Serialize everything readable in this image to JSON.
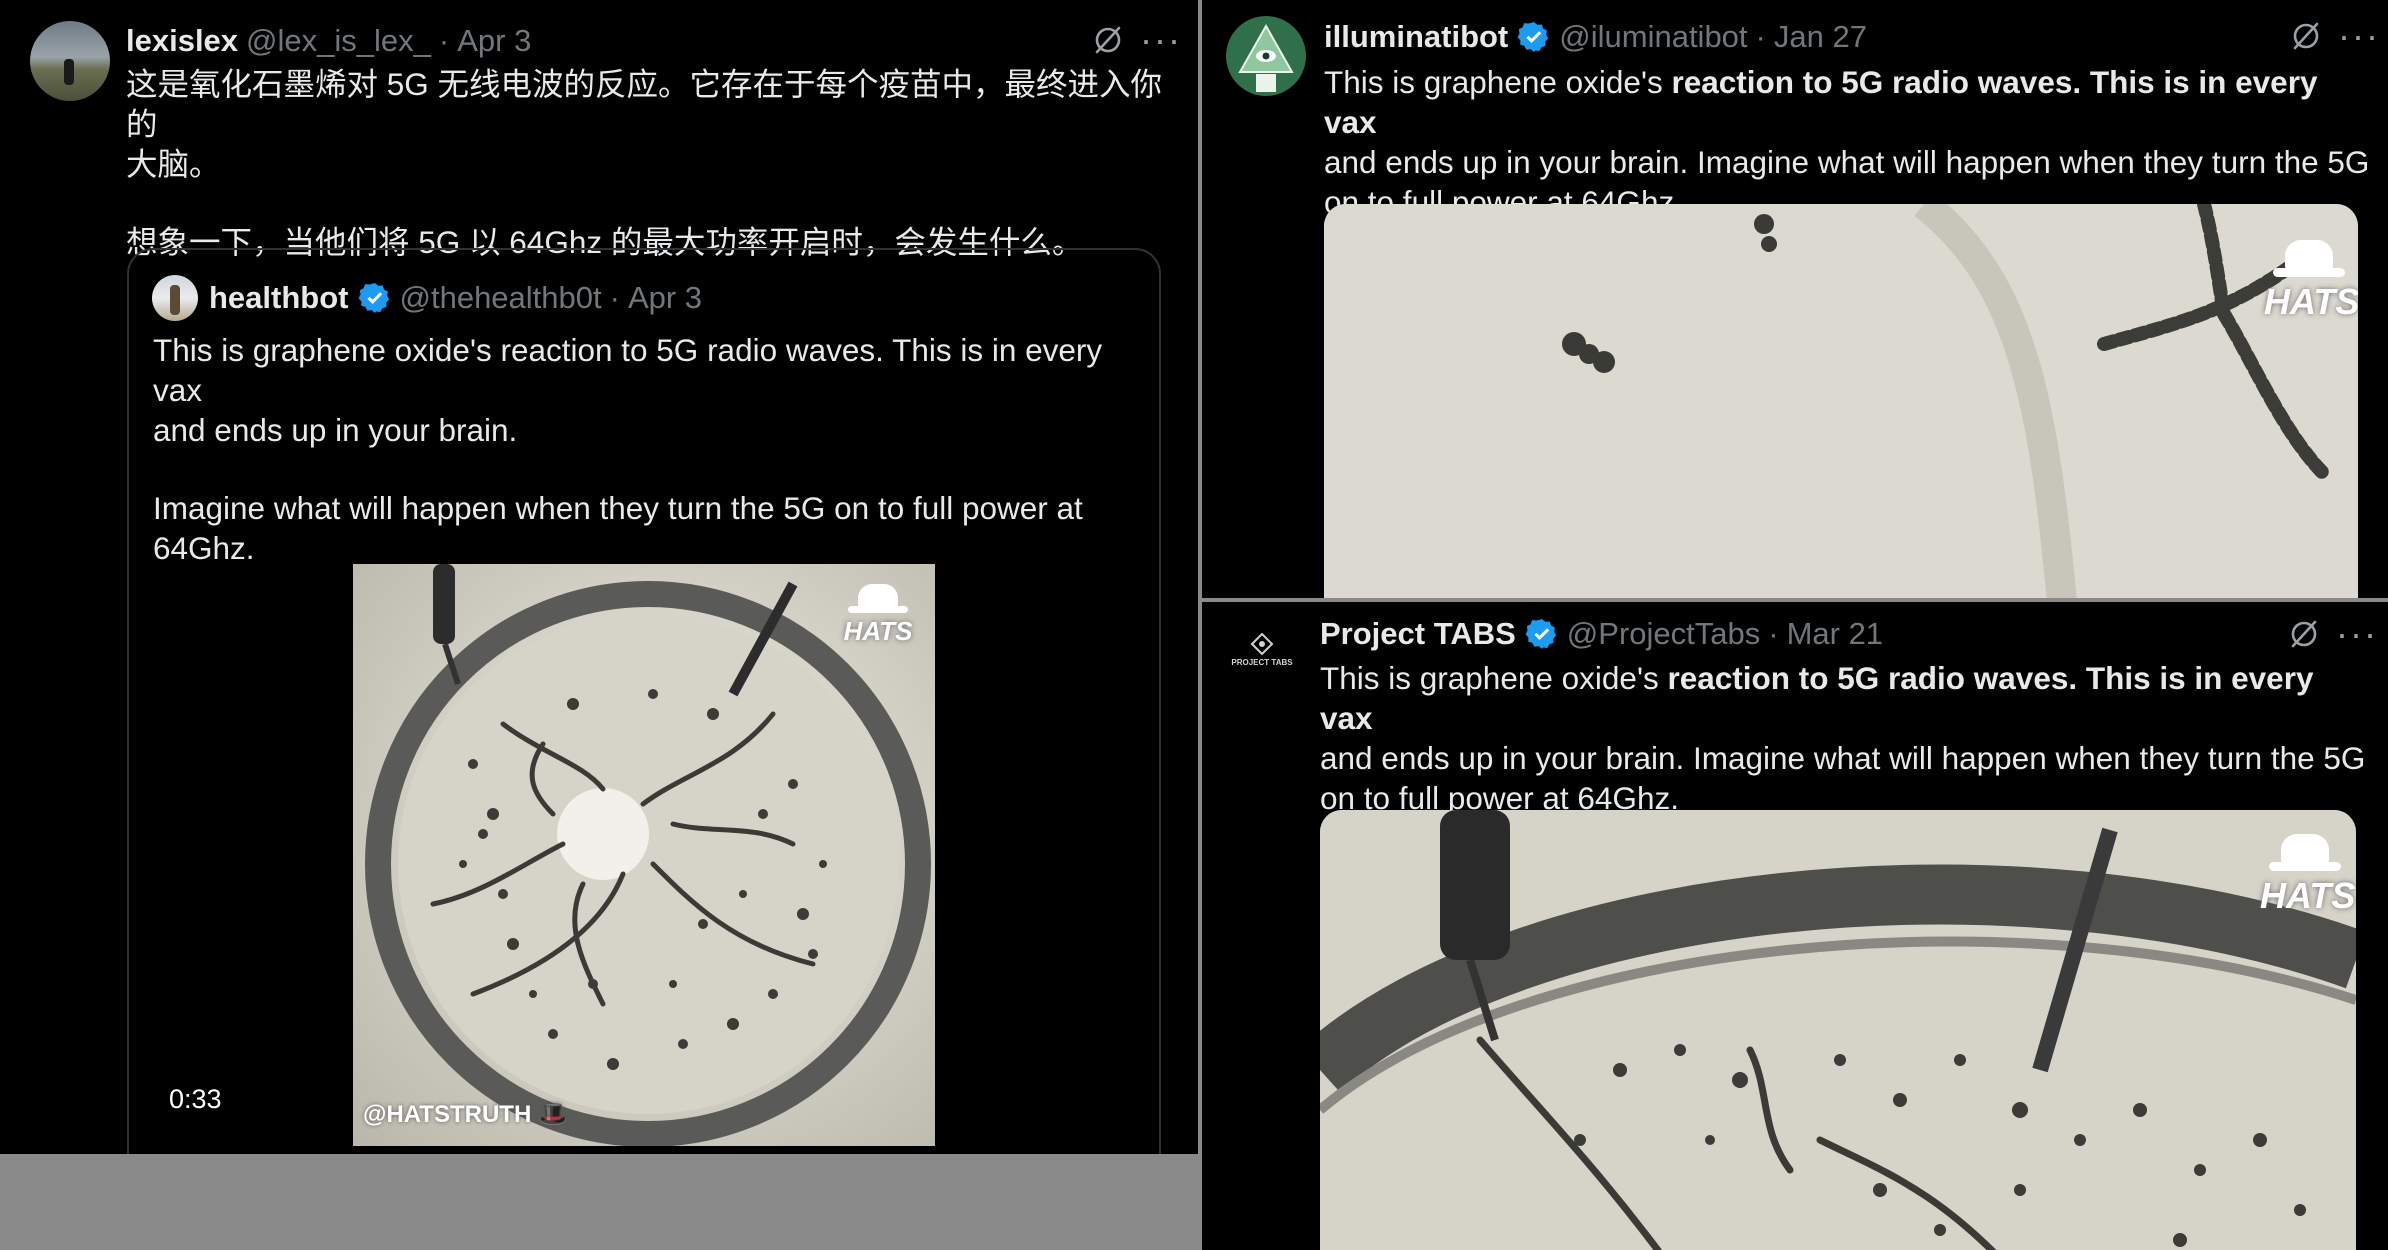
{
  "left_tweet": {
    "name": "lexislex",
    "handle": "@lex_is_lex_",
    "sep": "·",
    "date": "Apr 3",
    "more": "···",
    "text_line1": "这是氧化石墨烯对 5G 无线电波的反应。它存在于每个疫苗中，最终进入你的",
    "text_line2": "大脑。",
    "text_line3": "想象一下，当他们将 5G 以 64Ghz 的最大功率开启时，会发生什么。",
    "quoted": {
      "name": "healthbot",
      "handle": "@thehealthb0t",
      "sep": "·",
      "date": "Apr 3",
      "text_line1": "This is graphene oxide's reaction to 5G radio waves. This is in every vax",
      "text_line2": "and ends up in your brain.",
      "text_line3": "Imagine what will happen when they turn the 5G on to full power at",
      "text_line4": "64Ghz.",
      "video": {
        "duration": "0:33",
        "watermark": "@HATSTRUTH 🎩",
        "logo": "HATS"
      }
    }
  },
  "right_top_tweet": {
    "name": "illuminatibot",
    "handle": "@iluminatibot",
    "sep": "·",
    "date": "Jan 27",
    "more": "···",
    "text_plain1": "This is graphene oxide's ",
    "text_bold1": "reaction to 5G radio waves. This is in every vax",
    "text_line2": "and ends up in your brain. Imagine what will happen when they turn the 5G",
    "text_line3": "on to full power at 64Ghz.",
    "logo": "HATS"
  },
  "right_bottom_tweet": {
    "name": "Project TABS",
    "handle": "@ProjectTabs",
    "sep": "·",
    "date": "Mar 21",
    "more": "···",
    "avatar_text": "PROJECT TABS",
    "text_plain1": "This is graphene oxide's ",
    "text_bold1": "reaction to 5G radio waves. This is in every vax",
    "text_line2": "and ends up in your brain. Imagine what will happen when they turn the 5G",
    "text_line3": "on to full power at 64Ghz.",
    "logo": "HATS"
  },
  "colors": {
    "background": "#000000",
    "text": "#e7e9ea",
    "muted": "#71767b",
    "verified": "#1d9bf0",
    "border": "#2f3336",
    "outer": "#8a8a8a"
  },
  "icons": [
    "verified-badge-icon",
    "grok-icon",
    "more-icon"
  ]
}
